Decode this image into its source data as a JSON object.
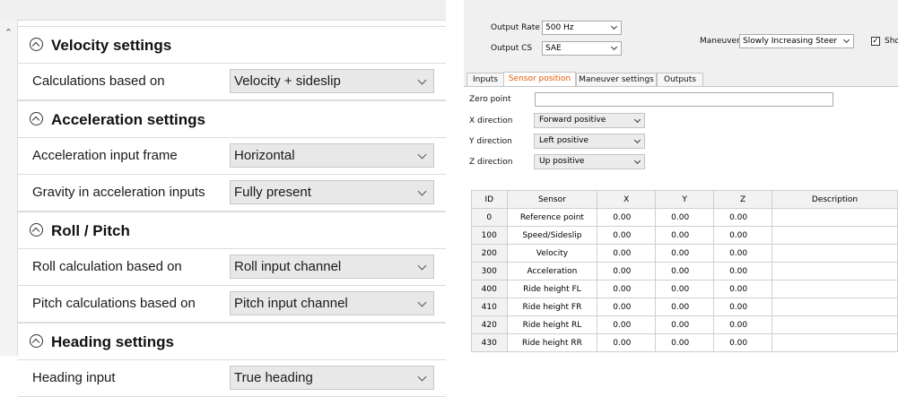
{
  "left_panel": {
    "sections": [
      {
        "title": "Velocity settings",
        "rows": [
          {
            "label": "Calculations based on",
            "value": "Velocity + sideslip"
          }
        ]
      },
      {
        "title": "Acceleration settings",
        "rows": [
          {
            "label": "Acceleration input frame",
            "value": "Horizontal"
          },
          {
            "label": "Gravity in acceleration inputs",
            "value": "Fully present"
          }
        ]
      },
      {
        "title": "Roll / Pitch",
        "rows": [
          {
            "label": "Roll calculation based on",
            "value": "Roll input channel"
          },
          {
            "label": "Pitch calculations based on",
            "value": "Pitch input channel"
          }
        ]
      },
      {
        "title": "Heading settings",
        "rows": [
          {
            "label": "Heading input",
            "value": "True heading"
          }
        ]
      }
    ]
  },
  "right_panel": {
    "header": {
      "output_rate": {
        "label": "Output Rate",
        "value": "500 Hz"
      },
      "output_cs": {
        "label": "Output CS",
        "value": "SAE"
      },
      "maneuver": {
        "label": "Maneuver",
        "value": "Slowly Increasing Steer"
      },
      "show_checkbox": {
        "label": "Sho",
        "checked": true
      }
    },
    "tabs": [
      {
        "label": "Inputs",
        "active": false
      },
      {
        "label": "Sensor position",
        "active": true
      },
      {
        "label": "Maneuver settings",
        "active": false
      },
      {
        "label": "Outputs",
        "active": false
      }
    ],
    "sensor_position": {
      "zero_point": {
        "label": "Zero point",
        "value": ""
      },
      "x_direction": {
        "label": "X direction",
        "value": "Forward positive"
      },
      "y_direction": {
        "label": "Y direction",
        "value": "Left positive"
      },
      "z_direction": {
        "label": "Z direction",
        "value": "Up positive"
      }
    },
    "table": {
      "columns": [
        "ID",
        "Sensor",
        "X",
        "Y",
        "Z",
        "Description"
      ],
      "rows": [
        [
          "0",
          "Reference point",
          "0.00",
          "0.00",
          "0.00",
          ""
        ],
        [
          "100",
          "Speed/Sideslip",
          "0.00",
          "0.00",
          "0.00",
          ""
        ],
        [
          "200",
          "Velocity",
          "0.00",
          "0.00",
          "0.00",
          ""
        ],
        [
          "300",
          "Acceleration",
          "0.00",
          "0.00",
          "0.00",
          ""
        ],
        [
          "400",
          "Ride height FL",
          "0.00",
          "0.00",
          "0.00",
          ""
        ],
        [
          "410",
          "Ride height FR",
          "0.00",
          "0.00",
          "0.00",
          ""
        ],
        [
          "420",
          "Ride height RL",
          "0.00",
          "0.00",
          "0.00",
          ""
        ],
        [
          "430",
          "Ride height RR",
          "0.00",
          "0.00",
          "0.00",
          ""
        ]
      ]
    }
  }
}
